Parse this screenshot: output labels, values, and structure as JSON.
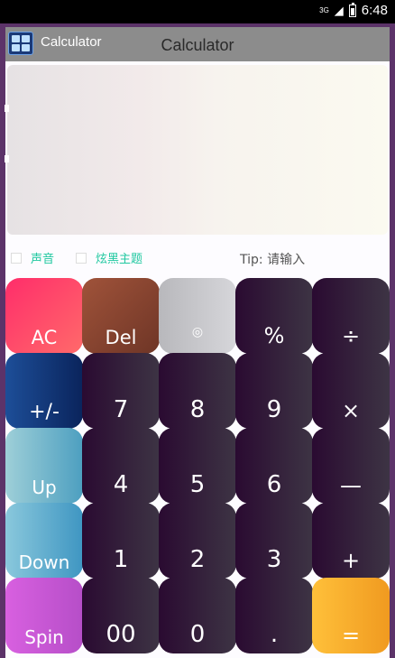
{
  "status_bar": {
    "network": "3G",
    "time": "6:48"
  },
  "titlebar": {
    "app_name": "Calculator",
    "window_title": "Calculator",
    "icon": "calculator-icon"
  },
  "options": {
    "sound": "声音",
    "cool_theme": "炫黑主题",
    "tip": "Tip: 请输入"
  },
  "keys": [
    [
      "AC",
      "Del",
      "◎",
      "%",
      "÷"
    ],
    [
      "+/-",
      "7",
      "8",
      "9",
      "×"
    ],
    [
      "Up",
      "4",
      "5",
      "6",
      "—"
    ],
    [
      "Down",
      "1",
      "2",
      "3",
      "+"
    ],
    [
      "Spin",
      "00",
      "0",
      ".",
      "="
    ]
  ],
  "colors": {
    "accent_red": "#ff2d6a",
    "accent_brown": "#8a4a35",
    "accent_silver": "#c4c4c8",
    "accent_navy": "#0b2b6a",
    "accent_teal": "#5aaec8",
    "accent_purple": "#c858d8",
    "accent_orange": "#f7a52a",
    "key_dark": "#2a0a31",
    "frame_purple": "#5c3369",
    "option_text": "#20c8a0"
  }
}
